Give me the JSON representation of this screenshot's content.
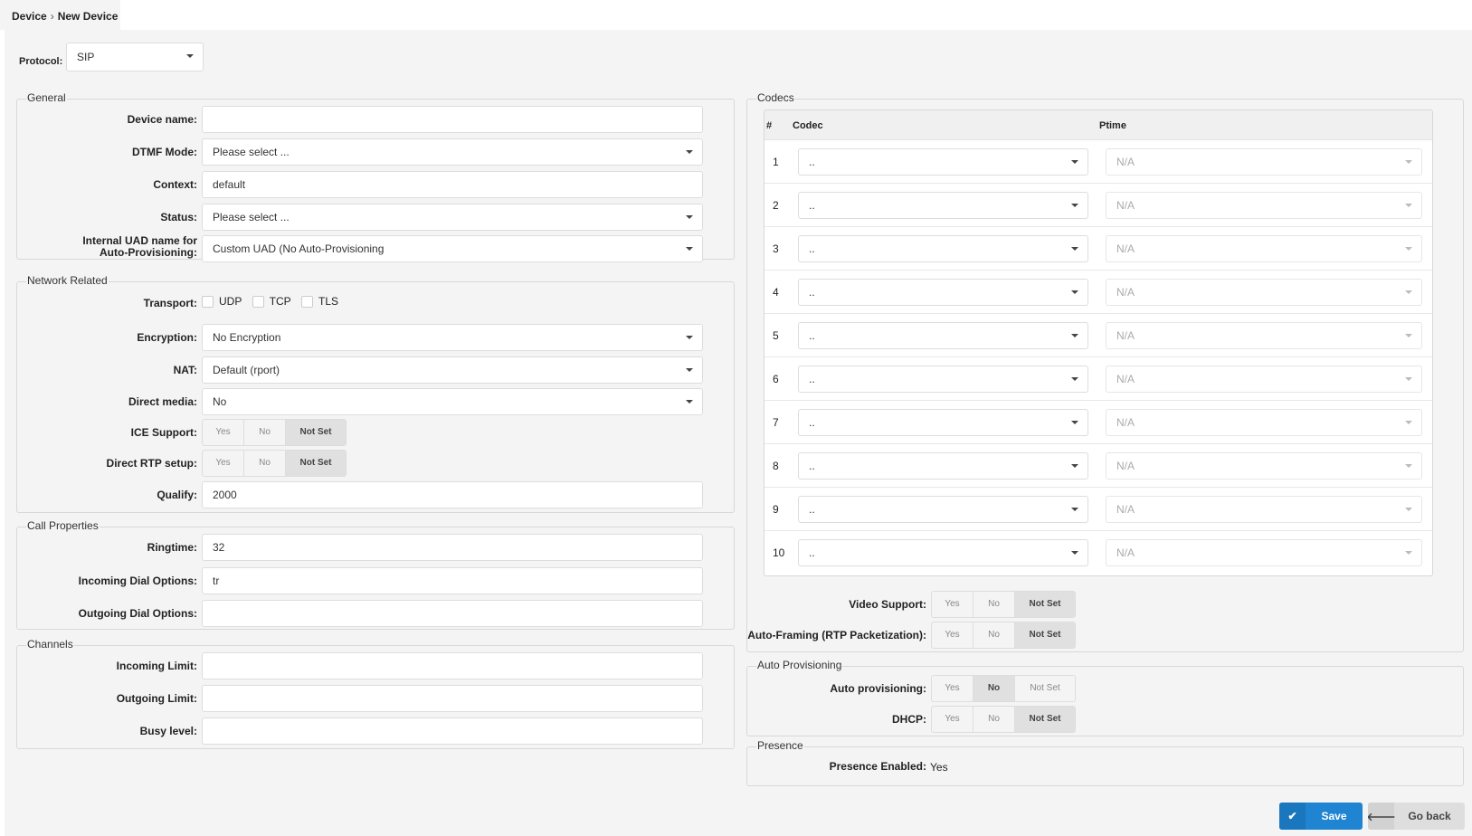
{
  "breadcrumb": {
    "root": "Device",
    "separator": "›",
    "current": "New Device"
  },
  "protocol": {
    "label": "Protocol:",
    "value": "SIP"
  },
  "general": {
    "legend": "General",
    "device_name": {
      "label": "Device name:",
      "value": ""
    },
    "dtmf_mode": {
      "label": "DTMF Mode:",
      "value": "Please select ..."
    },
    "context": {
      "label": "Context:",
      "value": "default"
    },
    "status": {
      "label": "Status:",
      "value": "Please select ..."
    },
    "uad": {
      "label_line1": "Internal UAD name for",
      "label_line2": "Auto-Provisioning:",
      "value": "Custom UAD (No Auto-Provisioning"
    }
  },
  "network": {
    "legend": "Network Related",
    "transport": {
      "label": "Transport:",
      "options": [
        "UDP",
        "TCP",
        "TLS"
      ]
    },
    "encryption": {
      "label": "Encryption:",
      "value": "No Encryption"
    },
    "nat": {
      "label": "NAT:",
      "value": "Default (rport)"
    },
    "direct_media": {
      "label": "Direct media:",
      "value": "No"
    },
    "ice_support": {
      "label": "ICE Support:",
      "selected": "Not Set"
    },
    "direct_rtp": {
      "label": "Direct RTP setup:",
      "selected": "Not Set"
    },
    "qualify": {
      "label": "Qualify:",
      "value": "2000"
    }
  },
  "toggle_labels": {
    "yes": "Yes",
    "no": "No",
    "not_set": "Not Set"
  },
  "call": {
    "legend": "Call Properties",
    "ringtime": {
      "label": "Ringtime:",
      "value": "32"
    },
    "incoming_dial": {
      "label": "Incoming Dial Options:",
      "value": "tr"
    },
    "outgoing_dial": {
      "label": "Outgoing Dial Options:",
      "value": ""
    }
  },
  "channels": {
    "legend": "Channels",
    "incoming_limit": {
      "label": "Incoming Limit:",
      "value": ""
    },
    "outgoing_limit": {
      "label": "Outgoing Limit:",
      "value": ""
    },
    "busy_level": {
      "label": "Busy level:",
      "value": ""
    }
  },
  "codecs": {
    "legend": "Codecs",
    "headers": {
      "num": "#",
      "codec": "Codec",
      "ptime": "Ptime"
    },
    "rows": [
      {
        "num": "1",
        "codec": "..",
        "ptime": "N/A"
      },
      {
        "num": "2",
        "codec": "..",
        "ptime": "N/A"
      },
      {
        "num": "3",
        "codec": "..",
        "ptime": "N/A"
      },
      {
        "num": "4",
        "codec": "..",
        "ptime": "N/A"
      },
      {
        "num": "5",
        "codec": "..",
        "ptime": "N/A"
      },
      {
        "num": "6",
        "codec": "..",
        "ptime": "N/A"
      },
      {
        "num": "7",
        "codec": "..",
        "ptime": "N/A"
      },
      {
        "num": "8",
        "codec": "..",
        "ptime": "N/A"
      },
      {
        "num": "9",
        "codec": "..",
        "ptime": "N/A"
      },
      {
        "num": "10",
        "codec": "..",
        "ptime": "N/A"
      }
    ],
    "video_support": {
      "label": "Video Support:",
      "selected": "Not Set"
    },
    "auto_framing": {
      "label": "Auto-Framing (RTP Packetization):",
      "selected": "Not Set"
    }
  },
  "auto_provisioning": {
    "legend": "Auto Provisioning",
    "auto_prov": {
      "label": "Auto provisioning:",
      "selected": "No"
    },
    "dhcp": {
      "label": "DHCP:",
      "selected": "Not Set"
    }
  },
  "presence": {
    "legend": "Presence",
    "label": "Presence Enabled:",
    "value": "Yes"
  },
  "actions": {
    "save": "Save",
    "go_back": "Go back",
    "save_color": "#1f84d1",
    "go_back_color": "#dedede"
  }
}
